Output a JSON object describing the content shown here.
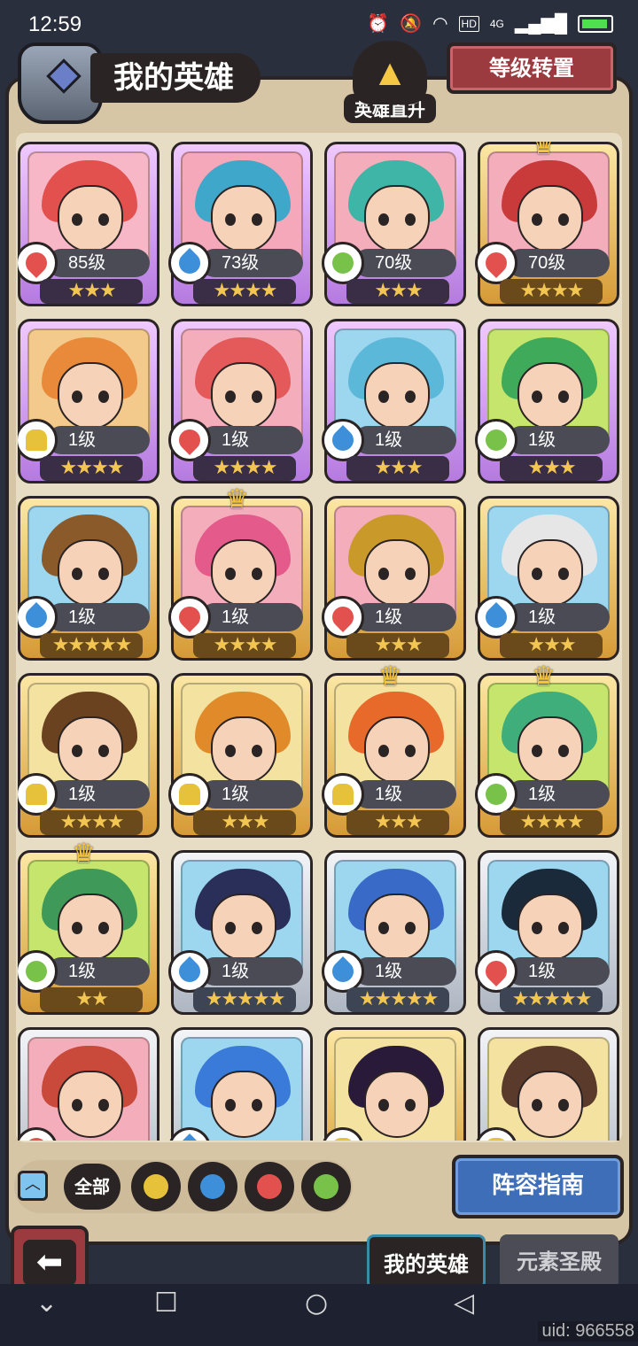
{
  "status_bar": {
    "time": "12:59",
    "network": "4G",
    "hd": "HD"
  },
  "header": {
    "title": "我的英雄",
    "direct_up_label": "英雄直升",
    "level_transfer_label": "等级转置"
  },
  "heroes": [
    {
      "level": "85级",
      "element": "fire",
      "stars": "★★★",
      "frame": "purple",
      "hair": "#e2514e",
      "bg": "#f7b7c7",
      "crown": false
    },
    {
      "level": "73级",
      "element": "water",
      "stars": "★★★★",
      "frame": "purple",
      "hair": "#3fa7c9",
      "bg": "#f4a8b9",
      "crown": false
    },
    {
      "level": "70级",
      "element": "wind",
      "stars": "★★★",
      "frame": "purple",
      "hair": "#3fb5a8",
      "bg": "#f4aebb",
      "crown": false
    },
    {
      "level": "70级",
      "element": "fire",
      "stars": "★★★★",
      "frame": "gold",
      "hair": "#c93a3a",
      "bg": "#f4aebb",
      "crown": true
    },
    {
      "level": "1级",
      "element": "earth",
      "stars": "★★★★",
      "frame": "purple",
      "hair": "#e88a3a",
      "bg": "#f3c98c",
      "crown": false
    },
    {
      "level": "1级",
      "element": "fire",
      "stars": "★★★★",
      "frame": "purple",
      "hair": "#e45a5a",
      "bg": "#f4aebb",
      "crown": false
    },
    {
      "level": "1级",
      "element": "water",
      "stars": "★★★",
      "frame": "purple",
      "hair": "#5cb8d8",
      "bg": "#9cd6ef",
      "crown": false
    },
    {
      "level": "1级",
      "element": "wind",
      "stars": "★★★",
      "frame": "purple",
      "hair": "#3faa5a",
      "bg": "#c6e56d",
      "crown": false
    },
    {
      "level": "1级",
      "element": "water",
      "stars": "★★★★★",
      "frame": "gold",
      "hair": "#8a5a2a",
      "bg": "#9cd6ef",
      "crown": false
    },
    {
      "level": "1级",
      "element": "fire",
      "stars": "★★★★",
      "frame": "gold",
      "hair": "#e45a8a",
      "bg": "#f4aebb",
      "crown": true
    },
    {
      "level": "1级",
      "element": "fire",
      "stars": "★★★",
      "frame": "gold",
      "hair": "#c99a2a",
      "bg": "#f4aebb",
      "crown": false
    },
    {
      "level": "1级",
      "element": "water",
      "stars": "★★★",
      "frame": "gold",
      "hair": "#e6e6e6",
      "bg": "#9cd6ef",
      "crown": false
    },
    {
      "level": "1级",
      "element": "earth",
      "stars": "★★★★",
      "frame": "gold",
      "hair": "#6a4220",
      "bg": "#f3e2a0",
      "crown": false
    },
    {
      "level": "1级",
      "element": "earth",
      "stars": "★★★",
      "frame": "gold",
      "hair": "#e08a2a",
      "bg": "#f3e2a0",
      "crown": false
    },
    {
      "level": "1级",
      "element": "earth",
      "stars": "★★★",
      "frame": "gold",
      "hair": "#e86a2a",
      "bg": "#f3e2a0",
      "crown": true
    },
    {
      "level": "1级",
      "element": "wind",
      "stars": "★★★★",
      "frame": "gold",
      "hair": "#3fae7a",
      "bg": "#c6e56d",
      "crown": true
    },
    {
      "level": "1级",
      "element": "wind",
      "stars": "★★",
      "frame": "gold",
      "hair": "#3f9a5a",
      "bg": "#c6e56d",
      "crown": true
    },
    {
      "level": "1级",
      "element": "water",
      "stars": "★★★★★",
      "frame": "silver",
      "hair": "#2a2f5a",
      "bg": "#9cd6ef",
      "crown": false
    },
    {
      "level": "1级",
      "element": "water",
      "stars": "★★★★★",
      "frame": "silver",
      "hair": "#3a6ac8",
      "bg": "#9cd6ef",
      "crown": false
    },
    {
      "level": "1级",
      "element": "fire",
      "stars": "★★★★★",
      "frame": "silver",
      "hair": "#1a2a3a",
      "bg": "#9cd6ef",
      "crown": false
    },
    {
      "level": "",
      "element": "fire",
      "stars": "",
      "frame": "silver",
      "hair": "#c94a3a",
      "bg": "#f4aebb",
      "crown": false
    },
    {
      "level": "",
      "element": "water",
      "stars": "",
      "frame": "silver",
      "hair": "#3a7ad8",
      "bg": "#9cd6ef",
      "crown": false
    },
    {
      "level": "",
      "element": "earth",
      "stars": "",
      "frame": "gold",
      "hair": "#2a1a3a",
      "bg": "#f3e2a0",
      "crown": false
    },
    {
      "level": "",
      "element": "earth",
      "stars": "",
      "frame": "silver",
      "hair": "#5a3a2a",
      "bg": "#f3e2a0",
      "crown": false
    }
  ],
  "filters": {
    "all_label": "全部",
    "elements": [
      "earth",
      "water",
      "fire",
      "wind"
    ]
  },
  "lineup_guide_label": "阵容指南",
  "tabs": {
    "my_heroes": "我的英雄",
    "element_sanctum": "元素圣殿"
  },
  "uid": "uid: 966558"
}
